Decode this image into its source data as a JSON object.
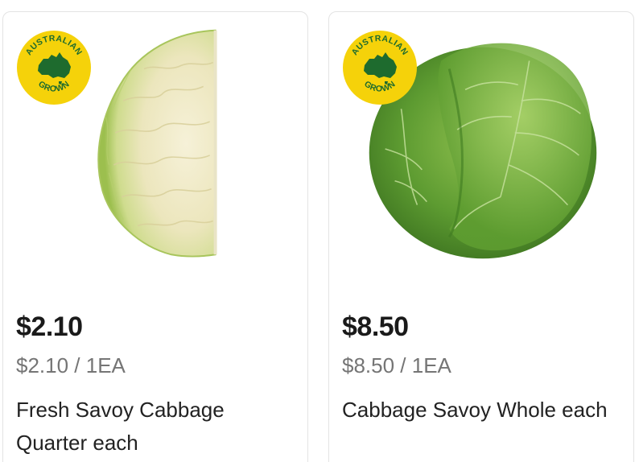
{
  "colors": {
    "badge_yellow": "#f5d20a",
    "badge_green": "#1e6b2e",
    "price_text": "#1a1a1a",
    "unit_text": "#757575",
    "card_border": "#e3e3e3"
  },
  "products": [
    {
      "badge_text_top": "AUSTRALIAN",
      "badge_text_bottom": "GROWN",
      "badge_icon": "australia-map-icon",
      "image": "savoy-cabbage-quarter",
      "price": "$2.10",
      "unit_price": "$2.10 / 1EA",
      "name": "Fresh Savoy Cabbage Quarter each"
    },
    {
      "badge_text_top": "AUSTRALIAN",
      "badge_text_bottom": "GROWN",
      "badge_icon": "australia-map-icon",
      "image": "savoy-cabbage-whole",
      "price": "$8.50",
      "unit_price": "$8.50 / 1EA",
      "name": "Cabbage Savoy Whole each"
    }
  ]
}
